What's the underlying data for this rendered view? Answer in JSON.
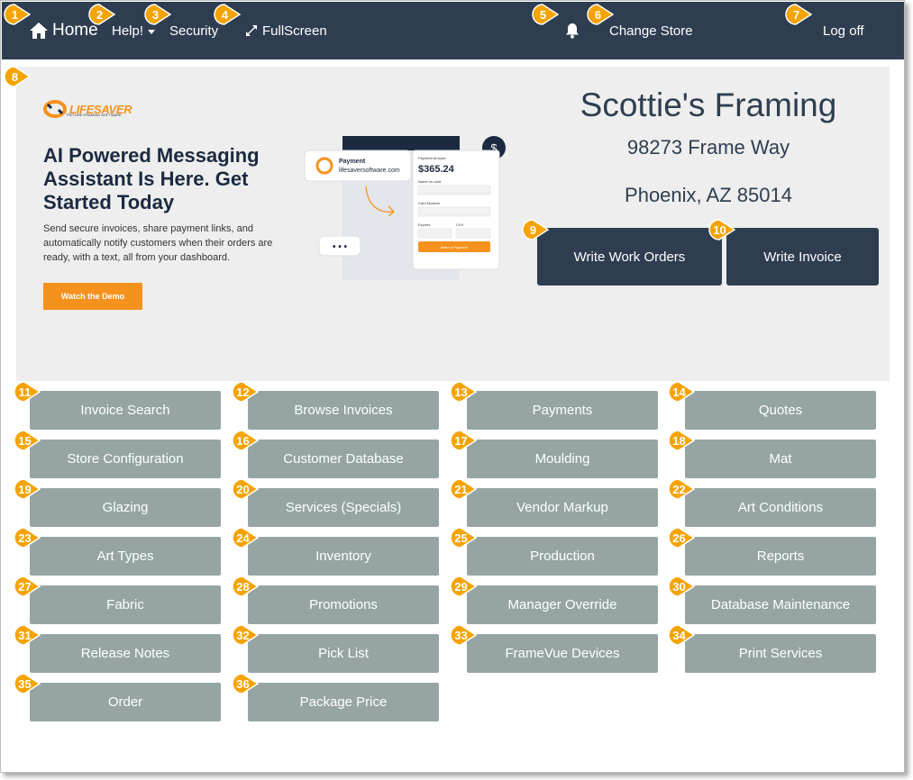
{
  "nav": {
    "home": "Home",
    "help": "Help!",
    "security": "Security",
    "fullscreen": "FullScreen",
    "change_store": "Change Store",
    "log_off": "Log off"
  },
  "ad": {
    "logo_text": "LIFESAVER",
    "logo_sub": "PICTURE FRAMING SOFTWARE",
    "headline": "AI Powered Messaging Assistant Is Here. Get Started Today",
    "body": "Send secure invoices, share payment links, and automatically notify customers when their orders are ready, with a text, all from your dashboard.",
    "cta": "Watch the Demo",
    "card_payment_label": "Payment",
    "card_payment_site": "lifesaversoftware.com",
    "card_amount_label": "Payment Amount",
    "card_amount": "$365.24",
    "card_name_label": "Name on card",
    "card_number_label": "Card Number",
    "card_expiry_label": "Expires",
    "card_cvv_label": "CVV",
    "card_submit": "Make a Payment",
    "dots": "• • •",
    "dollar": "$"
  },
  "store": {
    "name": "Scottie's Framing",
    "address1": "98273 Frame Way",
    "address2": "Phoenix, AZ 85014"
  },
  "actions": {
    "write_work_orders": "Write Work Orders",
    "write_invoice": "Write Invoice"
  },
  "grid": [
    "Invoice Search",
    "Browse Invoices",
    "Payments",
    "Quotes",
    "Store Configuration",
    "Customer Database",
    "Moulding",
    "Mat",
    "Glazing",
    "Services (Specials)",
    "Vendor Markup",
    "Art Conditions",
    "Art Types",
    "Inventory",
    "Production",
    "Reports",
    "Fabric",
    "Promotions",
    "Manager Override",
    "Database Maintenance",
    "Release Notes",
    "Pick List",
    "FrameVue Devices",
    "Print Services",
    "Order",
    "Package Price"
  ],
  "badges": [
    "1",
    "2",
    "3",
    "4",
    "5",
    "6",
    "7",
    "8",
    "9",
    "10",
    "11",
    "12",
    "13",
    "14",
    "15",
    "16",
    "17",
    "18",
    "19",
    "20",
    "21",
    "22",
    "23",
    "24",
    "25",
    "26",
    "27",
    "28",
    "29",
    "30",
    "31",
    "32",
    "33",
    "34",
    "35",
    "36"
  ],
  "colors": {
    "nav_bg": "#2e3e50",
    "grid_btn": "#96a5a4",
    "badge": "#f5a300",
    "accent": "#f5921e"
  }
}
